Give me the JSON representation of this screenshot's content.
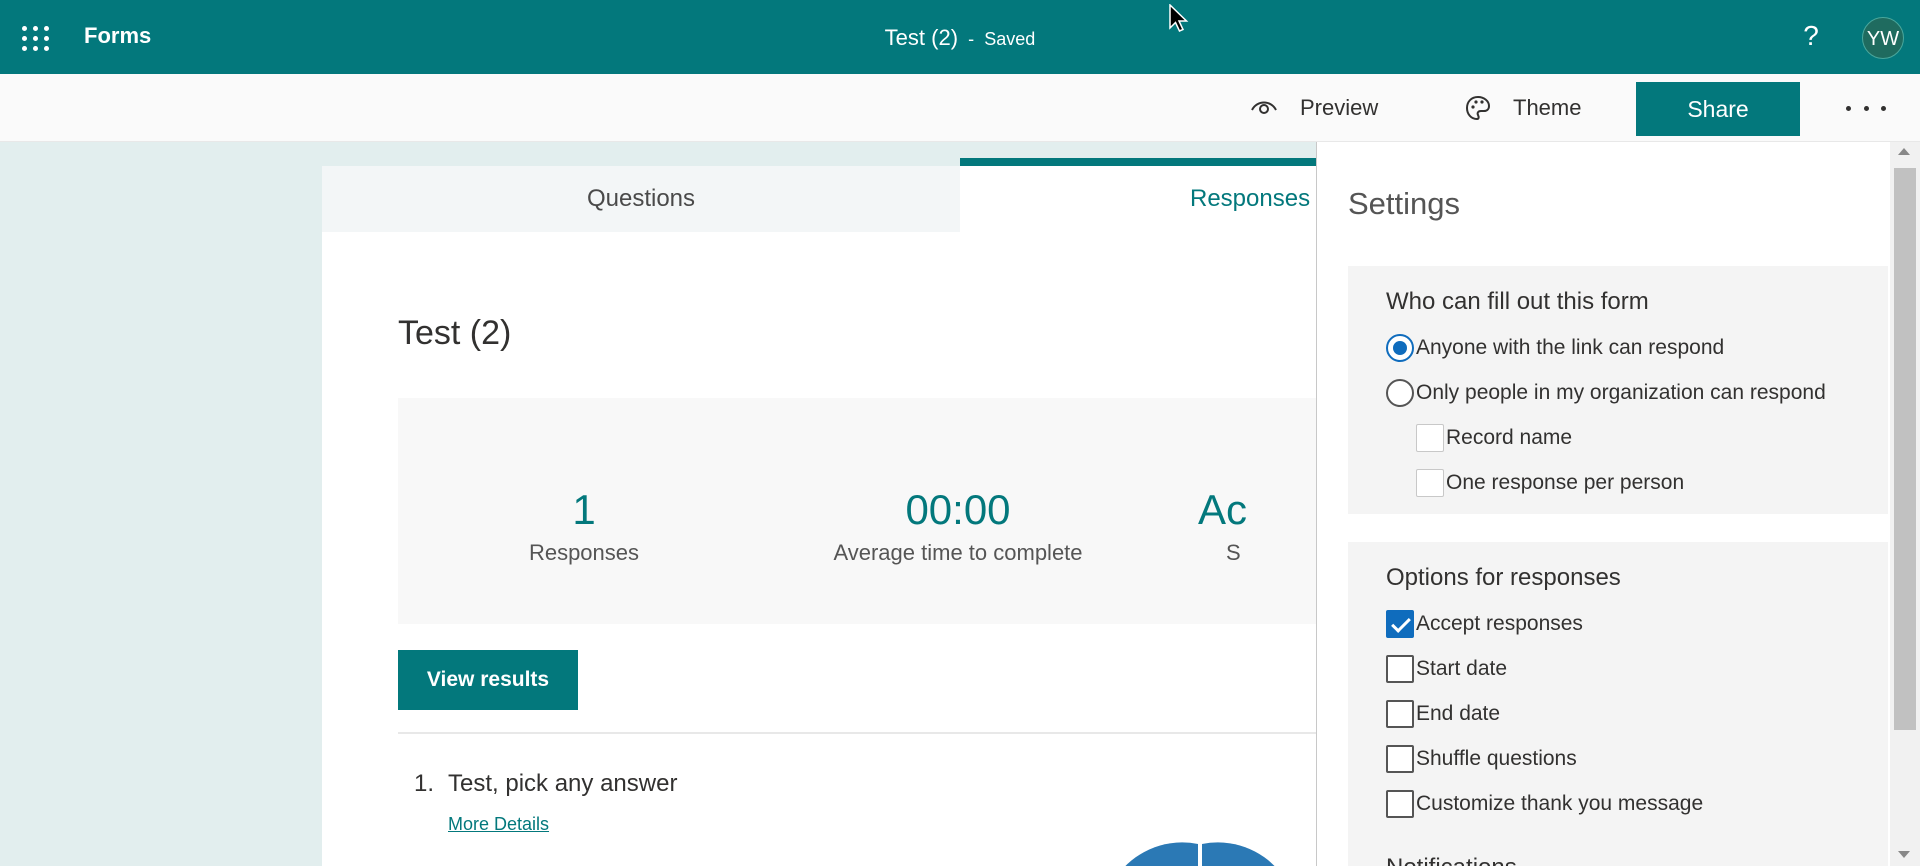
{
  "appbar": {
    "app_name": "Forms",
    "doc_title": "Test (2)",
    "separator": "-",
    "save_status": "Saved",
    "help": "?",
    "avatar_initials": "YW",
    "color": "#03787c"
  },
  "cmdbar": {
    "preview_label": "Preview",
    "theme_label": "Theme",
    "share_label": "Share"
  },
  "tabs": {
    "questions": "Questions",
    "responses": "Responses",
    "active": "Responses"
  },
  "form": {
    "title": "Test (2)",
    "stats": [
      {
        "value": "1",
        "label": "Responses"
      },
      {
        "value": "00:00",
        "label": "Average time to complete"
      },
      {
        "value": "Ac",
        "label": "S"
      }
    ],
    "view_results": "View results",
    "question": {
      "number": "1.",
      "text": "Test, pick any answer",
      "link": "More Details"
    }
  },
  "settings": {
    "title": "Settings",
    "who_can_fill": {
      "heading": "Who can fill out this form",
      "options": [
        {
          "label": "Anyone with the link can respond",
          "selected": true
        },
        {
          "label": "Only people in my organization can respond",
          "selected": false
        }
      ],
      "sub_options": [
        {
          "label": "Record name",
          "checked": false
        },
        {
          "label": "One response per person",
          "checked": false
        }
      ]
    },
    "options_for_responses": {
      "heading": "Options for responses",
      "options": [
        {
          "label": "Accept responses",
          "checked": true
        },
        {
          "label": "Start date",
          "checked": false
        },
        {
          "label": "End date",
          "checked": false
        },
        {
          "label": "Shuffle questions",
          "checked": false
        },
        {
          "label": "Customize thank you message",
          "checked": false
        }
      ]
    },
    "notifications_heading": "Notifications"
  }
}
